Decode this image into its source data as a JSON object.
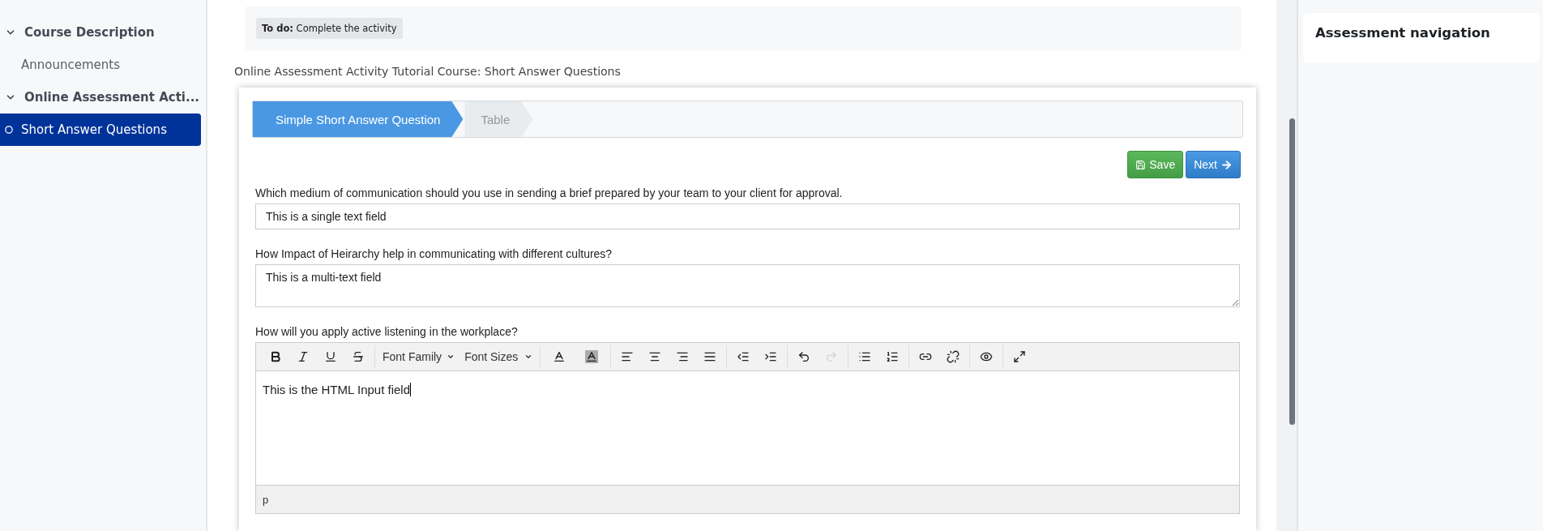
{
  "sidebar": {
    "items": [
      {
        "kind": "section",
        "label": "Course Description",
        "expanded": true,
        "selected": false
      },
      {
        "kind": "link",
        "label": "Announcements",
        "selected": false
      },
      {
        "kind": "section",
        "label": "Online Assessment Acti...",
        "expanded": true,
        "selected": false
      },
      {
        "kind": "page",
        "label": "Short Answer Questions",
        "selected": true
      }
    ]
  },
  "todo": "**To do:** Complete the activity",
  "page_title": "Online Assessment Activity Tutorial Course: Short Answer Questions",
  "steps": [
    {
      "label": "Simple Short Answer Question",
      "selected": true
    },
    {
      "label": "Table",
      "selected": false
    }
  ],
  "buttons": [
    {
      "kind": "save",
      "label": "Save"
    },
    {
      "kind": "next",
      "label": "Next"
    }
  ],
  "questions": [
    {
      "kind": "text",
      "prompt": "Which medium of communication should you use in sending a brief prepared by your team to your client for approval.",
      "value": "This is a single text field"
    },
    {
      "kind": "textarea",
      "prompt": "How Impact of Heirarchy help in communicating with different cultures?",
      "value": "This is a multi-text field"
    },
    {
      "kind": "html",
      "prompt": "How will you apply active listening in the workplace?",
      "value": "This is the HTML Input field",
      "status_path": "p",
      "toolbar": [
        [
          {
            "kind": "bold",
            "disabled": false
          },
          {
            "kind": "italic",
            "disabled": false
          },
          {
            "kind": "underline",
            "disabled": false
          },
          {
            "kind": "strike",
            "disabled": false
          }
        ],
        [
          {
            "kind": "dropdown",
            "label": "Font Family"
          },
          {
            "kind": "dropdown",
            "label": "Font Sizes"
          }
        ],
        [
          {
            "kind": "forecolor"
          },
          {
            "kind": "backcolor"
          }
        ],
        [
          {
            "kind": "align-left",
            "disabled": false
          },
          {
            "kind": "align-center",
            "disabled": false
          },
          {
            "kind": "align-right",
            "disabled": false
          },
          {
            "kind": "align-justify",
            "disabled": false
          }
        ],
        [
          {
            "kind": "outdent",
            "disabled": false
          },
          {
            "kind": "indent",
            "disabled": false
          }
        ],
        [
          {
            "kind": "undo",
            "disabled": false
          },
          {
            "kind": "redo",
            "disabled": true
          }
        ],
        [
          {
            "kind": "bullets",
            "disabled": false
          },
          {
            "kind": "numbers",
            "disabled": false
          }
        ],
        [
          {
            "kind": "link",
            "disabled": false
          },
          {
            "kind": "unlink",
            "disabled": false
          }
        ],
        [
          {
            "kind": "preview",
            "disabled": false
          }
        ],
        [
          {
            "kind": "fullscreen",
            "disabled": false
          }
        ]
      ]
    }
  ],
  "right_panel": {
    "title": "Assessment navigation"
  }
}
